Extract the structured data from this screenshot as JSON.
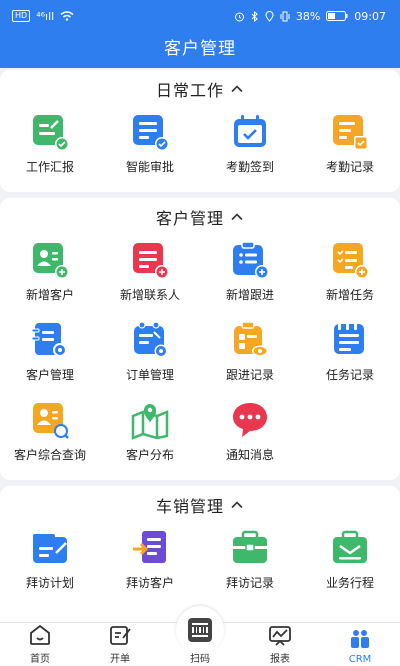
{
  "status_bar": {
    "left_badge": "HD",
    "signal": "⁴⁶ıll",
    "wifi": "wifi",
    "battery_percent": "38%",
    "time": "09:07"
  },
  "nav": {
    "title": "客户管理"
  },
  "sections": [
    {
      "title": "日常工作",
      "items": [
        {
          "label": "工作汇报",
          "icon": "report-check-icon",
          "color": "#3fb86b"
        },
        {
          "label": "智能审批",
          "icon": "approval-icon",
          "color": "#2f7ef0"
        },
        {
          "label": "考勤签到",
          "icon": "calendar-checkin-icon",
          "color": "#2f7ef0"
        },
        {
          "label": "考勤记录",
          "icon": "attendance-record-icon",
          "color": "#f5a623"
        }
      ]
    },
    {
      "title": "客户管理",
      "items": [
        {
          "label": "新增客户",
          "icon": "add-customer-icon",
          "color": "#3fb86b"
        },
        {
          "label": "新增联系人",
          "icon": "add-contact-icon",
          "color": "#e8384f"
        },
        {
          "label": "新增跟进",
          "icon": "add-followup-icon",
          "color": "#2f7ef0"
        },
        {
          "label": "新增任务",
          "icon": "add-task-icon",
          "color": "#f5a623"
        },
        {
          "label": "客户管理",
          "icon": "customer-manage-icon",
          "color": "#2f7ef0"
        },
        {
          "label": "订单管理",
          "icon": "order-manage-icon",
          "color": "#2f7ef0"
        },
        {
          "label": "跟进记录",
          "icon": "followup-record-icon",
          "color": "#f5a623"
        },
        {
          "label": "任务记录",
          "icon": "task-record-icon",
          "color": "#2f7ef0"
        },
        {
          "label": "客户综合查询",
          "icon": "customer-search-icon",
          "color": "#f5a623"
        },
        {
          "label": "客户分布",
          "icon": "map-pin-icon",
          "color": "#3fb86b"
        },
        {
          "label": "通知消息",
          "icon": "chat-bubble-icon",
          "color": "#e8384f"
        }
      ]
    },
    {
      "title": "车销管理",
      "items": [
        {
          "label": "拜访计划",
          "icon": "visit-plan-icon",
          "color": "#2f7ef0"
        },
        {
          "label": "拜访客户",
          "icon": "visit-customer-icon",
          "color": "#6a4cd6"
        },
        {
          "label": "拜访记录",
          "icon": "visit-record-icon",
          "color": "#3fb86b"
        },
        {
          "label": "业务行程",
          "icon": "business-trip-icon",
          "color": "#3fb86b"
        }
      ]
    }
  ],
  "tabs": [
    {
      "label": "首页",
      "icon": "home-icon"
    },
    {
      "label": "开单",
      "icon": "order-edit-icon"
    },
    {
      "label": "扫码",
      "icon": "scan-icon"
    },
    {
      "label": "报表",
      "icon": "report-chart-icon"
    },
    {
      "label": "CRM",
      "icon": "crm-users-icon",
      "active": true
    }
  ]
}
